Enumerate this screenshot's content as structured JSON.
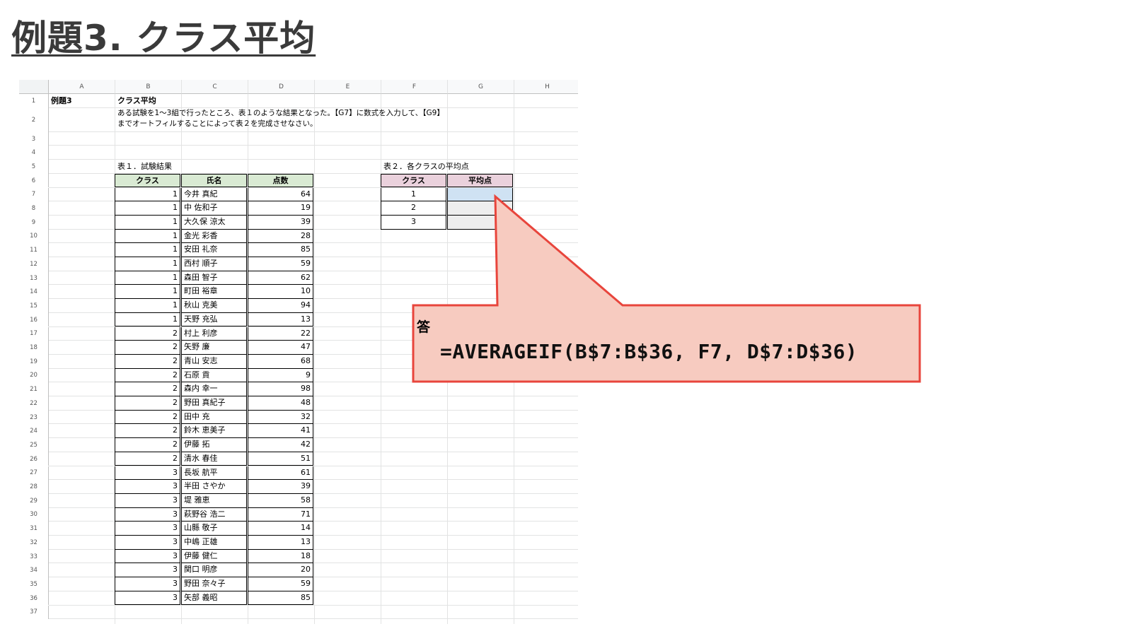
{
  "slide": {
    "title": "例題3. クラス平均"
  },
  "sheet": {
    "columns": [
      "A",
      "B",
      "C",
      "D",
      "E",
      "F",
      "G",
      "H"
    ],
    "row_numbers": [
      "1",
      "2",
      "3",
      "4",
      "5",
      "6",
      "7",
      "8",
      "9",
      "10",
      "11",
      "12",
      "13",
      "14",
      "15",
      "16",
      "17",
      "18",
      "19",
      "20",
      "21",
      "22",
      "23",
      "24",
      "25",
      "26",
      "27",
      "28",
      "29",
      "30",
      "31",
      "32",
      "33",
      "34",
      "35",
      "36",
      "37"
    ],
    "a1": "例題3",
    "b1": "クラス平均",
    "b2_line1": "ある試験を1〜3組で行ったところ、表１のような結果となった。【G7】に数式を入力して、【G9】",
    "b2_line2": "までオートフィルすることによって表２を完成させなさい。",
    "table1": {
      "caption": "表１．試験結果",
      "headers": [
        "クラス",
        "氏名",
        "点数"
      ],
      "rows": [
        {
          "cls": "1",
          "name": "今井 真紀",
          "score": "64"
        },
        {
          "cls": "1",
          "name": "中 佐和子",
          "score": "19"
        },
        {
          "cls": "1",
          "name": "大久保 涼太",
          "score": "39"
        },
        {
          "cls": "1",
          "name": "金光 彩香",
          "score": "28"
        },
        {
          "cls": "1",
          "name": "安田 礼奈",
          "score": "85"
        },
        {
          "cls": "1",
          "name": "西村 順子",
          "score": "59"
        },
        {
          "cls": "1",
          "name": "森田 智子",
          "score": "62"
        },
        {
          "cls": "1",
          "name": "町田 裕章",
          "score": "10"
        },
        {
          "cls": "1",
          "name": "秋山 克美",
          "score": "94"
        },
        {
          "cls": "1",
          "name": "天野 充弘",
          "score": "13"
        },
        {
          "cls": "2",
          "name": "村上 利彦",
          "score": "22"
        },
        {
          "cls": "2",
          "name": "矢野 廉",
          "score": "47"
        },
        {
          "cls": "2",
          "name": "青山 安志",
          "score": "68"
        },
        {
          "cls": "2",
          "name": "石原 貢",
          "score": "9"
        },
        {
          "cls": "2",
          "name": "森内 幸一",
          "score": "98"
        },
        {
          "cls": "2",
          "name": "野田 真紀子",
          "score": "48"
        },
        {
          "cls": "2",
          "name": "田中 充",
          "score": "32"
        },
        {
          "cls": "2",
          "name": "鈴木 恵美子",
          "score": "41"
        },
        {
          "cls": "2",
          "name": "伊藤 拓",
          "score": "42"
        },
        {
          "cls": "2",
          "name": "清水 春佳",
          "score": "51"
        },
        {
          "cls": "3",
          "name": "長坂 航平",
          "score": "61"
        },
        {
          "cls": "3",
          "name": "半田 さやか",
          "score": "39"
        },
        {
          "cls": "3",
          "name": "堤 雅恵",
          "score": "58"
        },
        {
          "cls": "3",
          "name": "萩野谷 浩二",
          "score": "71"
        },
        {
          "cls": "3",
          "name": "山縣 敬子",
          "score": "14"
        },
        {
          "cls": "3",
          "name": "中嶋 正雄",
          "score": "13"
        },
        {
          "cls": "3",
          "name": "伊藤 健仁",
          "score": "18"
        },
        {
          "cls": "3",
          "name": "関口 明彦",
          "score": "20"
        },
        {
          "cls": "3",
          "name": "野田 奈々子",
          "score": "59"
        },
        {
          "cls": "3",
          "name": "矢部 義昭",
          "score": "85"
        }
      ]
    },
    "table2": {
      "caption": "表２．各クラスの平均点",
      "headers": [
        "クラス",
        "平均点"
      ],
      "rows": [
        "1",
        "2",
        "3"
      ]
    }
  },
  "answer": {
    "label": "答",
    "formula": "=AVERAGEIF(B$7:B$36, F7, D$7:D$36)"
  },
  "colors": {
    "table1_header": "#d9ead3",
    "table2_header": "#ead1dc",
    "selected_cell": "#cfe2f3",
    "callout_fill": "#f7cbc0",
    "callout_border": "#e8453c"
  }
}
